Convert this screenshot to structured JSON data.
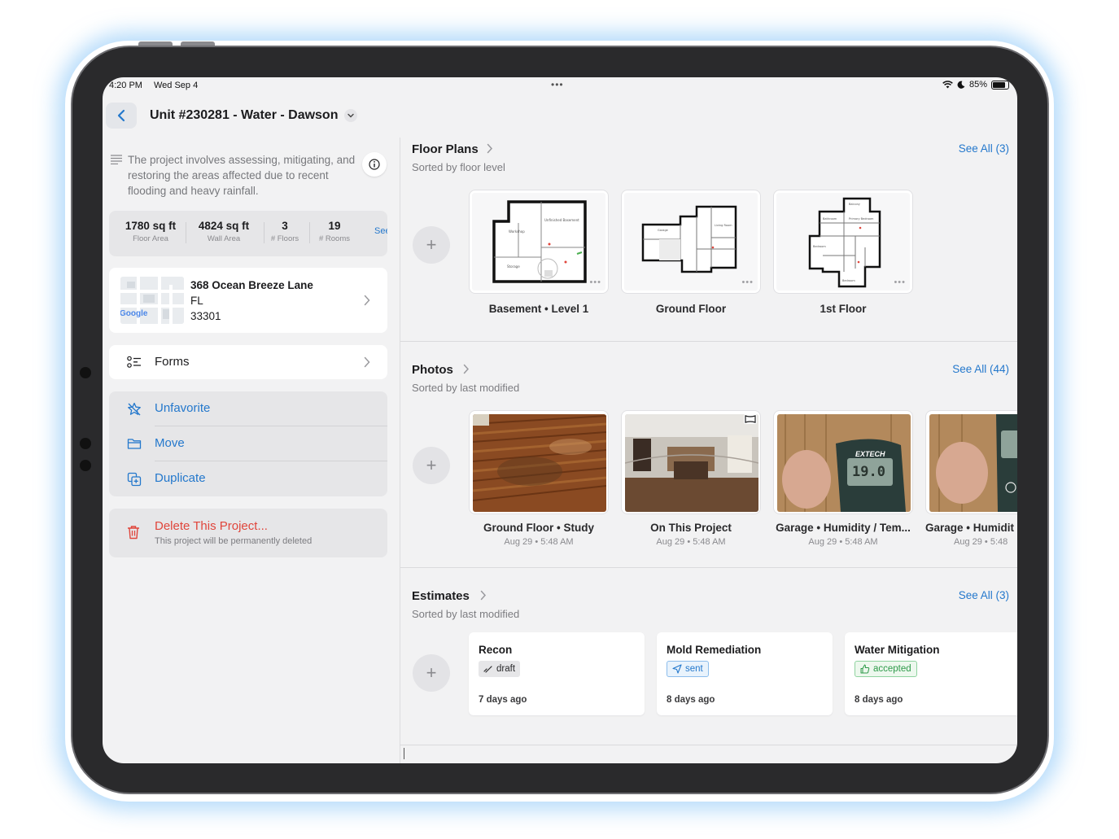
{
  "status": {
    "time": "4:20 PM",
    "date": "Wed Sep 4",
    "battery": "85%"
  },
  "nav": {
    "title": "Unit #230281 - Water - Dawson"
  },
  "project": {
    "description": "The project involves assessing, mitigating, and restoring the areas affected due to recent flooding and heavy rainfall.",
    "stats": [
      {
        "value": "1780 sq ft",
        "label": "Floor Area"
      },
      {
        "value": "4824 sq ft",
        "label": "Wall Area"
      },
      {
        "value": "3",
        "label": "# Floors"
      },
      {
        "value": "19",
        "label": "# Rooms"
      }
    ],
    "see_more": "See",
    "address": {
      "street": "368 Ocean Breeze Lane",
      "state": "FL",
      "zip": "33301",
      "map_text": "Google"
    },
    "forms_label": "Forms",
    "actions": {
      "unfavorite": "Unfavorite",
      "move": "Move",
      "duplicate": "Duplicate"
    },
    "delete": {
      "title": "Delete This Project...",
      "subtitle": "This project will be permanently deleted"
    }
  },
  "floor_plans": {
    "title": "Floor Plans",
    "subtitle": "Sorted by floor level",
    "see_all": "See All (3)",
    "items": [
      {
        "label": "Basement • Level 1"
      },
      {
        "label": "Ground Floor"
      },
      {
        "label": "1st Floor"
      }
    ]
  },
  "photos": {
    "title": "Photos",
    "subtitle": "Sorted by last modified",
    "see_all": "See All (44)",
    "items": [
      {
        "title": "Ground Floor • Study",
        "date": "Aug 29 • 5:48 AM"
      },
      {
        "title": "On This Project",
        "date": "Aug 29 • 5:48 AM"
      },
      {
        "title": "Garage • Humidity / Tem...",
        "date": "Aug 29 • 5:48 AM",
        "meter_brand": "EXTECH",
        "meter_reading": "19.0"
      },
      {
        "title": "Garage • Humidit",
        "date": "Aug 29 • 5:48"
      }
    ]
  },
  "estimates": {
    "title": "Estimates",
    "subtitle": "Sorted by last modified",
    "see_all": "See All (3)",
    "items": [
      {
        "title": "Recon",
        "status": "draft",
        "age": "7 days ago"
      },
      {
        "title": "Mold Remediation",
        "status": "sent",
        "age": "8 days ago"
      },
      {
        "title": "Water Mitigation",
        "status": "accepted",
        "age": "8 days ago"
      }
    ]
  },
  "colors": {
    "accent": "#2478cc",
    "danger": "#e0453b",
    "accepted": "#2e9a4a"
  }
}
